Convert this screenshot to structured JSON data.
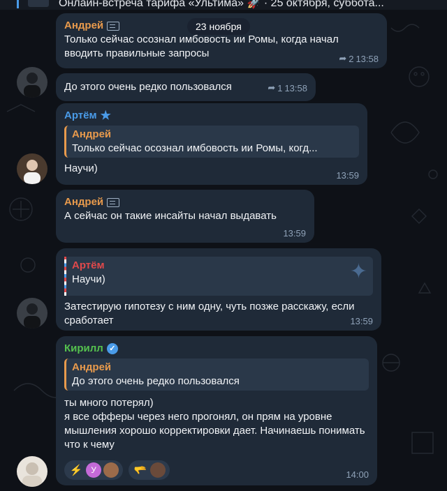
{
  "pinned": {
    "text": "Онлайн-встреча тарифа «Ультима» 🚀 · 25 октября, суббота..."
  },
  "date_label": "23 ноября",
  "messages": [
    {
      "author": "Андрей",
      "author_color": "#e89a4c",
      "text": "Только сейчас осознал имбовость ии Ромы, когда начал вводить правильные запросы",
      "replies": "2",
      "time": "13:58"
    },
    {
      "text": "До этого очень редко пользовался",
      "replies": "1",
      "time": "13:58"
    },
    {
      "author": "Артём",
      "author_color": "#4a9be8",
      "quote_author": "Андрей",
      "quote_text": "Только сейчас осознал имбовость ии Ромы, когд...",
      "text": "Научи)",
      "time": "13:59"
    },
    {
      "author": "Андрей",
      "author_color": "#e89a4c",
      "text": "А сейчас он такие инсайты начал выдавать",
      "time": "13:59"
    },
    {
      "quote_author": "Артём",
      "quote_text": "Научи)",
      "text": "Затестирую гипотезу с ним одну, чуть позже расскажу, если сработает",
      "time": "13:59"
    },
    {
      "author": "Кирилл",
      "author_color": "#55c24e",
      "quote_author": "Андрей",
      "quote_text": "До этого очень редко пользовался",
      "text": "ты много потерял)\nя все офферы через него прогонял, он прям на уровне мышления хорошо корректировки дает. Начинаешь понимать что к чему",
      "time": "14:00"
    }
  ],
  "reactions": [
    {
      "emoji": "⚡",
      "avatar_letter": "У"
    },
    {
      "emoji": "🫳"
    }
  ]
}
